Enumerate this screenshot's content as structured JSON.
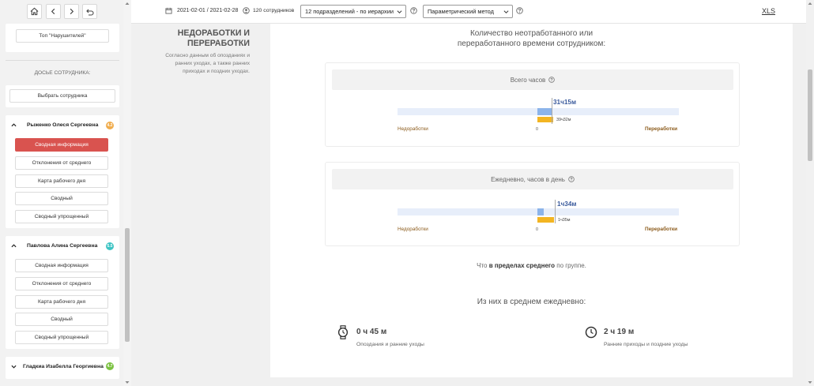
{
  "toolbar": {
    "date_range": "2021-02-01 / 2021-02-28",
    "employees": "120 сотрудников",
    "units_select": "12 подразделений - по иерархии",
    "method_select": "Параметрический метод",
    "export_label": "XLS"
  },
  "sidebar": {
    "top_violators": "Топ \"Нарушителей\"",
    "dossier_title": "ДОСЬЕ СОТРУДНИКА:",
    "choose_employee": "Выбрать сотрудника",
    "persons": [
      {
        "name": "Рыженко Олеся Сергеевна",
        "badge": "4.2",
        "badge_color": "#f0ad4e",
        "items": [
          "Сводная информация",
          "Отклонения от среднего",
          "Карта рабочего дня",
          "Сводный",
          "Сводный упрощенный"
        ]
      },
      {
        "name": "Павлова Алина Сергеевна",
        "badge": "5.5",
        "badge_color": "#3ec4c4",
        "items": [
          "Сводная информация",
          "Отклонения от среднего",
          "Карта рабочего дня",
          "Сводный",
          "Сводный упрощенный"
        ]
      },
      {
        "name": "Гладкиа Изабелла Георгиевна",
        "badge": "4.7",
        "badge_color": "#7cc242"
      }
    ]
  },
  "section": {
    "title_line1": "НЕДОРАБОТКИ И",
    "title_line2": "ПЕРЕРАБОТКИ",
    "desc_line1": "Согласно данным об опозданиях и",
    "desc_line2": "ранних уходах, а также ранних",
    "desc_line3": "приходах и поздних уходах."
  },
  "main": {
    "heading_line1": "Количество неотработанного или",
    "heading_line2": "переработанного времени сотрудником:",
    "total": {
      "title": "Всего часов",
      "value": "31ч15м",
      "overtime_fraction": 0.15,
      "sub_value": "39ч32м",
      "undertime_fraction": 0.055,
      "left_label": "Недоработки",
      "zero_label": "0",
      "right_label": "Переработки"
    },
    "daily": {
      "title": "Ежедневно, часов в день",
      "value": "1ч34м",
      "overtime_fraction": 0.07,
      "sub_value": "1ч35м",
      "undertime_fraction": 0.06,
      "left_label": "Недоработки",
      "zero_label": "0",
      "right_label": "Переработки"
    },
    "status_prefix": "Что",
    "status_bold": "в пределах среднего",
    "status_suffix": "по группе.",
    "daily_avg_title": "Из них в среднем ежедневно:",
    "late": {
      "value": "0 ч 45 м",
      "label": "Опоздания и ранние уходы"
    },
    "early": {
      "value": "2 ч 19 м",
      "label": "Ранние приходы и поздние уходы"
    }
  }
}
